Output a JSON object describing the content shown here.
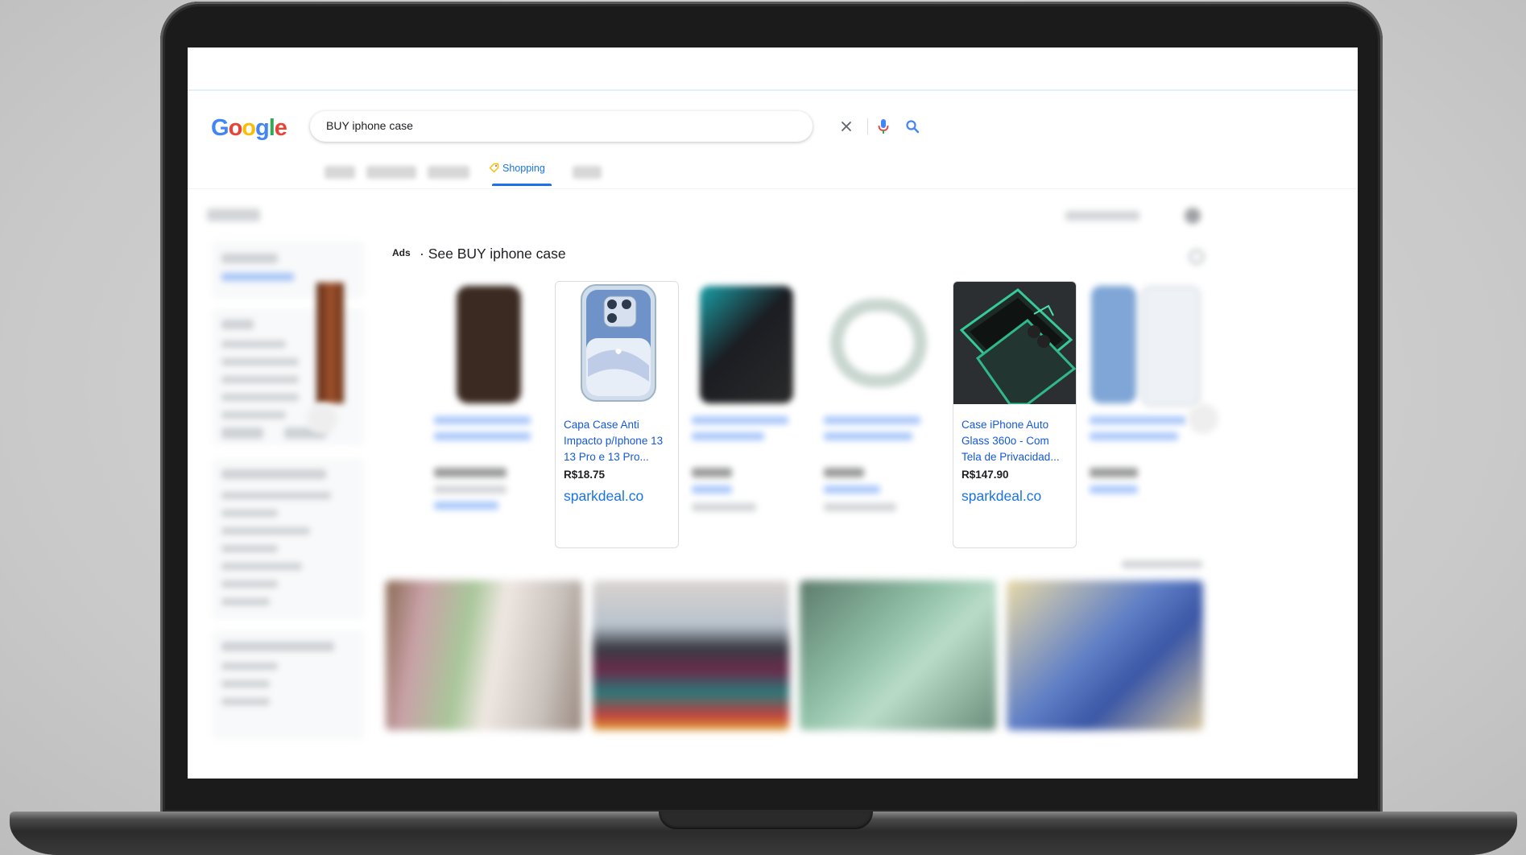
{
  "search": {
    "query": "BUY iphone case"
  },
  "logo": {
    "letters": [
      "G",
      "o",
      "o",
      "g",
      "l",
      "e"
    ]
  },
  "tabs": {
    "active_label": "Shopping"
  },
  "ads": {
    "label": "Ads",
    "title": "· See BUY iphone case"
  },
  "products": [
    {
      "title": "Capa Case Anti Impacto p/Iphone 13 13 Pro e 13 Pro...",
      "price": "R$18.75",
      "seller": "sparkdeal.co"
    },
    {
      "title": "Case iPhone Auto Glass 360o - Com Tela de Privacidad...",
      "price": "R$147.90",
      "seller": "sparkdeal.co"
    }
  ],
  "colors": {
    "accent": "#1a73e8",
    "link": "#1558d6",
    "bezel": "#1b1b1b",
    "backdrop": "#c9c9c9"
  },
  "icons": [
    "clear-icon",
    "microphone-icon",
    "search-icon",
    "price-tag-icon"
  ]
}
